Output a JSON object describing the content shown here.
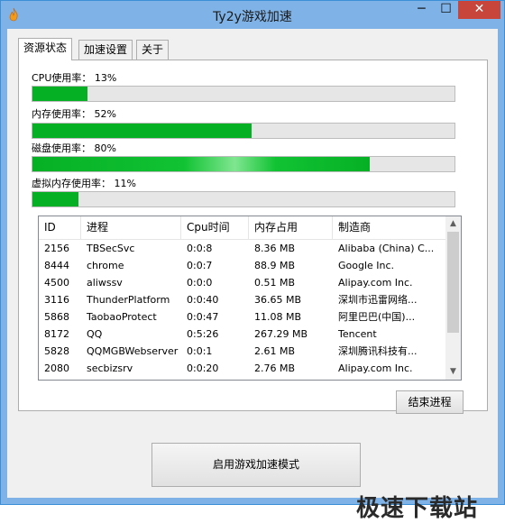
{
  "window": {
    "title": "Ty2y游戏加速",
    "controls": {
      "minimize": "─",
      "maximize": "☐",
      "close": "✕"
    }
  },
  "tabs": [
    {
      "label": "资源状态",
      "active": true
    },
    {
      "label": "加速设置",
      "active": false
    },
    {
      "label": "关于",
      "active": false
    }
  ],
  "metrics": {
    "cpu": {
      "label": "CPU使用率： 13%",
      "percent": 13
    },
    "memory": {
      "label": "内存使用率： 52%",
      "percent": 52
    },
    "disk": {
      "label": "磁盘使用率： 80%",
      "percent": 80
    },
    "virtual": {
      "label": "虚拟内存使用率： 11%",
      "percent": 11
    }
  },
  "process_table": {
    "columns": [
      "ID",
      "进程",
      "Cpu时间",
      "内存占用",
      "制造商"
    ],
    "rows": [
      [
        "2156",
        "TBSecSvc",
        "0:0:8",
        "8.36 MB",
        "Alibaba (China) C..."
      ],
      [
        "8444",
        "chrome",
        "0:0:7",
        "88.9 MB",
        "Google Inc."
      ],
      [
        "4500",
        "aliwssv",
        "0:0:0",
        "0.51 MB",
        "Alipay.com Inc."
      ],
      [
        "3116",
        "ThunderPlatform",
        "0:0:40",
        "36.65 MB",
        "深圳市迅雷网络..."
      ],
      [
        "5868",
        "TaobaoProtect",
        "0:0:47",
        "11.08 MB",
        "阿里巴巴(中国)..."
      ],
      [
        "8172",
        "QQ",
        "0:5:26",
        "267.29 MB",
        "Tencent"
      ],
      [
        "5828",
        "QQMGBWebserver",
        "0:0:1",
        "2.61 MB",
        "深圳腾讯科技有..."
      ],
      [
        "2080",
        "secbizsrv",
        "0:0:20",
        "2.76 MB",
        "Alipay.com Inc."
      ]
    ]
  },
  "buttons": {
    "end_process": "结束进程",
    "start_boost": "启用游戏加速模式"
  },
  "watermark": "极速下载站",
  "colors": {
    "progress": "#06b025",
    "titlebar": "#7fb2e6",
    "close": "#c7453a"
  }
}
